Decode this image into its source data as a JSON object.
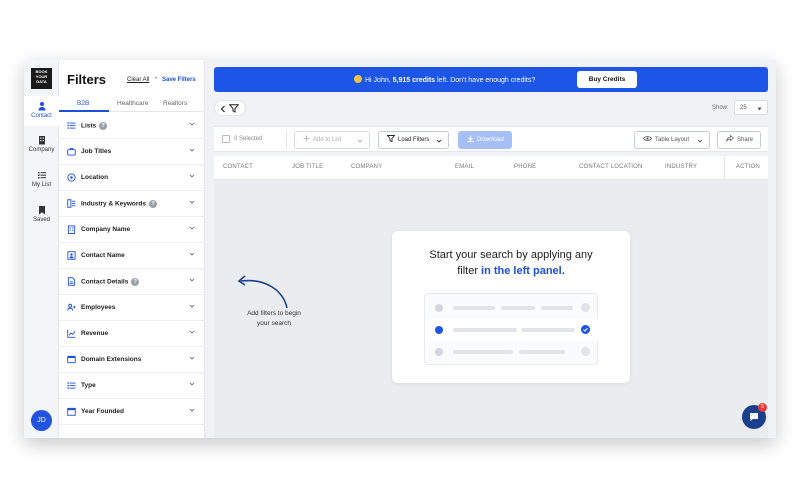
{
  "app": {
    "logo_lines": [
      "BOOK",
      "YOUR",
      "DATA"
    ],
    "avatar_initials": "JD"
  },
  "rail": {
    "items": [
      {
        "label": "Contact",
        "icon": "person-icon",
        "active": true
      },
      {
        "label": "Company",
        "icon": "building-icon",
        "active": false
      },
      {
        "label": "My List",
        "icon": "list-icon",
        "active": false
      },
      {
        "label": "Saved",
        "icon": "bookmark-icon",
        "active": false
      }
    ]
  },
  "filters": {
    "title": "Filters",
    "clear_all": "Clear All",
    "separator": "•",
    "save_filters": "Save Filters",
    "tabs": [
      "B2B",
      "Healthcare",
      "Realtors"
    ],
    "active_tab": "B2B",
    "items": [
      {
        "label": "Lists",
        "icon": "list-icon",
        "info": true
      },
      {
        "label": "Job Titles",
        "icon": "briefcase-icon",
        "info": false
      },
      {
        "label": "Location",
        "icon": "location-pin-icon",
        "info": false
      },
      {
        "label": "Industry & Keywords",
        "icon": "tag-icon",
        "info": true
      },
      {
        "label": "Company Name",
        "icon": "building-icon",
        "info": false
      },
      {
        "label": "Contact Name",
        "icon": "id-card-icon",
        "info": false
      },
      {
        "label": "Contact Details",
        "icon": "document-icon",
        "info": true
      },
      {
        "label": "Employees",
        "icon": "users-icon",
        "info": false
      },
      {
        "label": "Revenue",
        "icon": "chart-line-icon",
        "info": false
      },
      {
        "label": "Domain Extensions",
        "icon": "globe-icon",
        "info": false
      },
      {
        "label": "Type",
        "icon": "list-icon",
        "info": false
      },
      {
        "label": "Year Founded",
        "icon": "calendar-icon",
        "info": false
      }
    ],
    "info_glyph": "?"
  },
  "banner": {
    "greeting": "Hi John, ",
    "credits": "5,915 credits",
    "rest": " left. Don't have enough credits?",
    "buy_label": "Buy Credits"
  },
  "toolbar": {
    "show_label": "Show:",
    "show_value": "25",
    "selected_label": "0 Selected",
    "add_to_list": "Add to List",
    "load_filters": "Load Filters",
    "download": "Download",
    "table_layout": "Table Layout",
    "share": "Share"
  },
  "table": {
    "columns": [
      "CONTACT",
      "JOB TITLE",
      "COMPANY",
      "EMAIL",
      "PHONE",
      "CONTACT LOCATION",
      "INDUSTRY",
      "ACTION"
    ]
  },
  "empty_state": {
    "line1": "Start your search by applying any",
    "line2_plain": "filter ",
    "line2_highlight": "in the left panel."
  },
  "hint": {
    "line1": "Add filters to begin",
    "line2": "your search"
  },
  "chat": {
    "badge": "6"
  },
  "colors": {
    "primary": "#1d55e6",
    "dark_blue": "#1a3f8c",
    "badge_red": "#e43a3a"
  }
}
